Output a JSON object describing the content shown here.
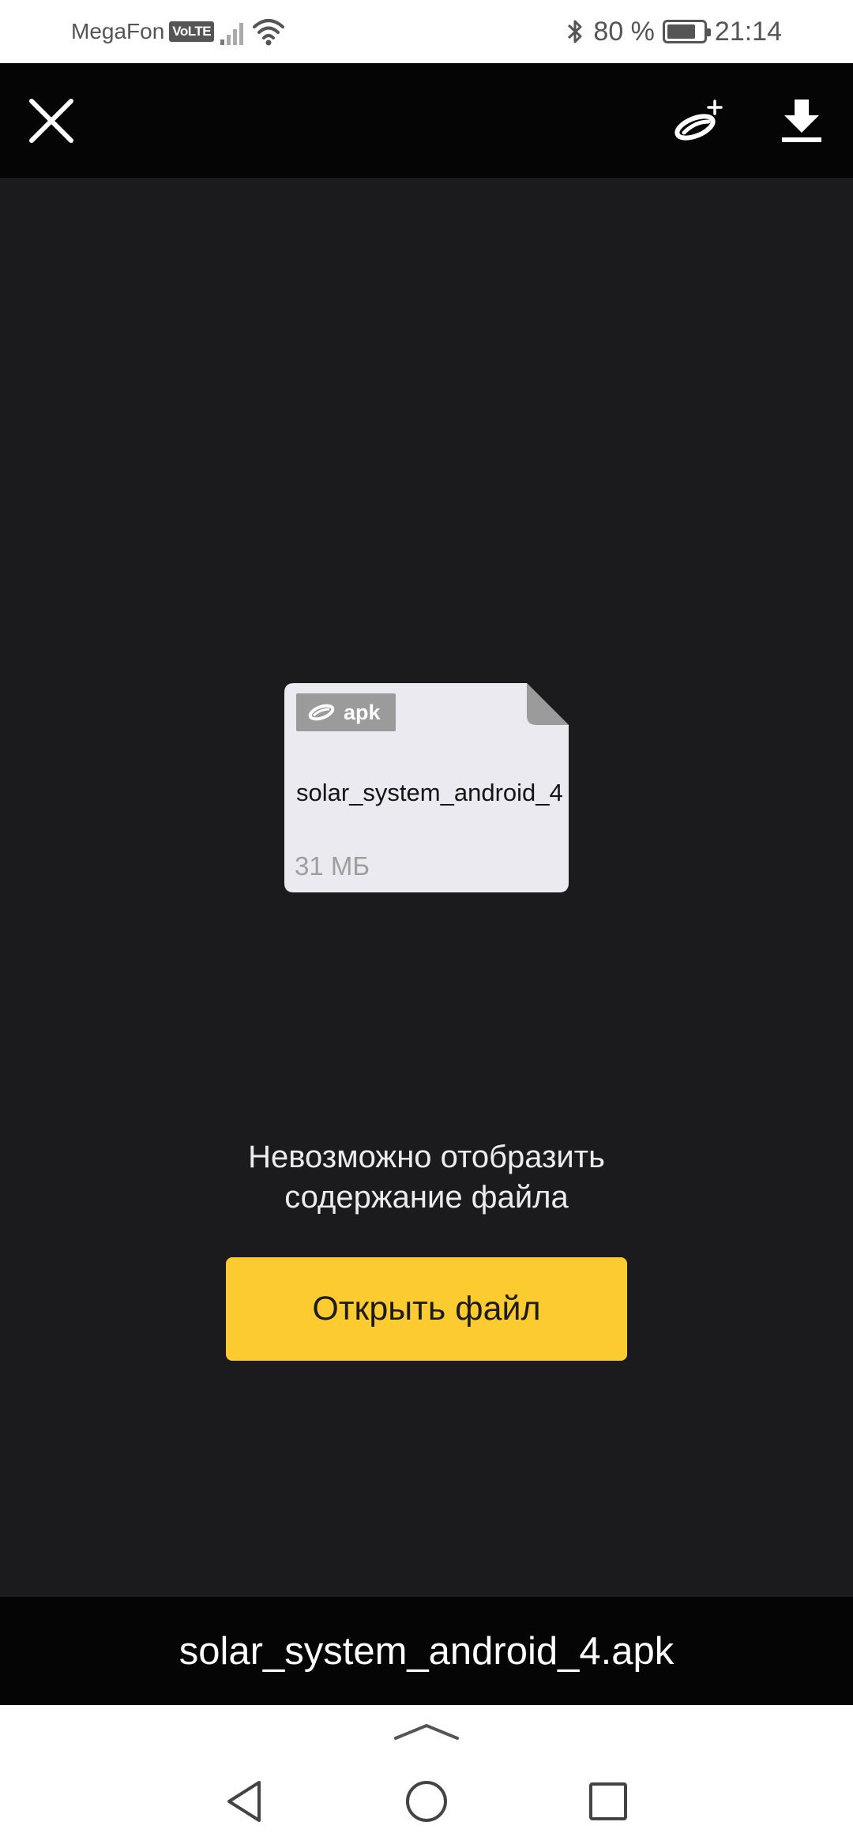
{
  "status_bar": {
    "carrier": "MegaFon",
    "volte": "VoLTE",
    "battery_text": "80 %",
    "battery_level": 0.8,
    "time": "21:14"
  },
  "toolbar": {
    "icons": [
      "close-icon",
      "disk-save-icon",
      "download-icon"
    ]
  },
  "file_card": {
    "badge_label": "apk",
    "name": "solar_system_android_4",
    "size": "31 МБ"
  },
  "message": {
    "line1": "Невозможно отобразить",
    "line2": "содержание файла"
  },
  "open_button_label": "Открыть файл",
  "file_title": "solar_system_android_4.apk",
  "colors": {
    "accent": "#fccb2f",
    "background": "#1b1b1d",
    "bar": "#050505",
    "card": "#ebeaf0"
  }
}
